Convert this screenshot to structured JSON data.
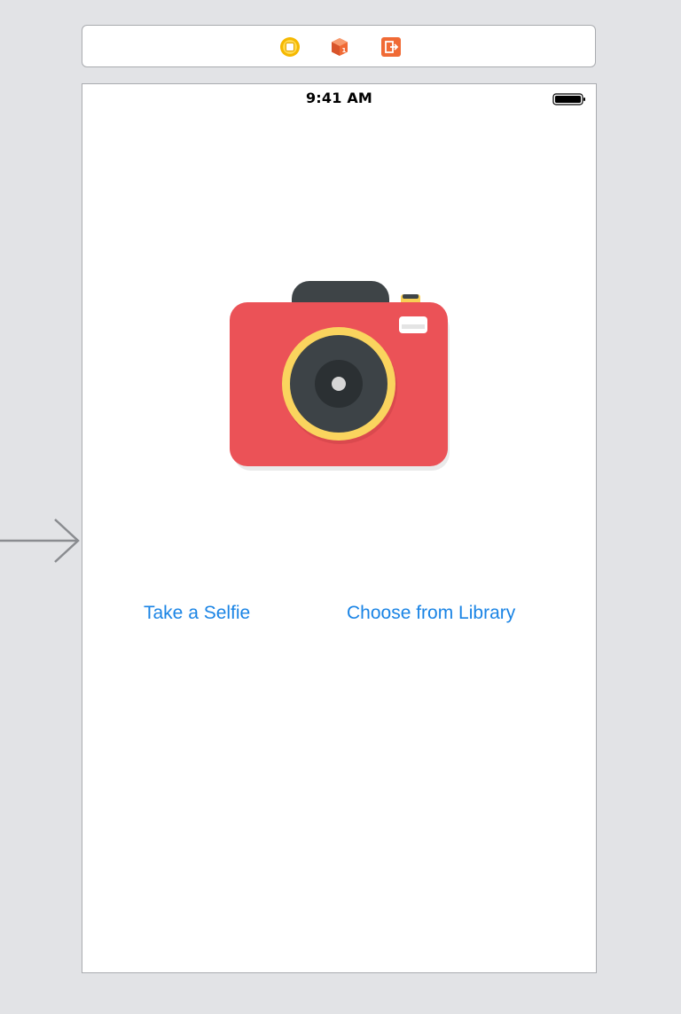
{
  "dock": {
    "icons": [
      "view-controller-icon",
      "first-responder-icon",
      "exit-icon"
    ],
    "colors": {
      "view_controller": "#f5b800",
      "first_responder": "#f06a35",
      "exit": "#f06a35"
    }
  },
  "status_bar": {
    "time": "9:41 AM"
  },
  "main": {
    "camera_icon": "camera-icon",
    "take_selfie_label": "Take a Selfie",
    "choose_library_label": "Choose from Library"
  },
  "colors": {
    "canvas_background": "#e2e3e6",
    "button_text": "#1a84e5",
    "camera_body": "#eb5257",
    "lens_ring": "#fad45e",
    "lens_dark": "#3d4347"
  }
}
